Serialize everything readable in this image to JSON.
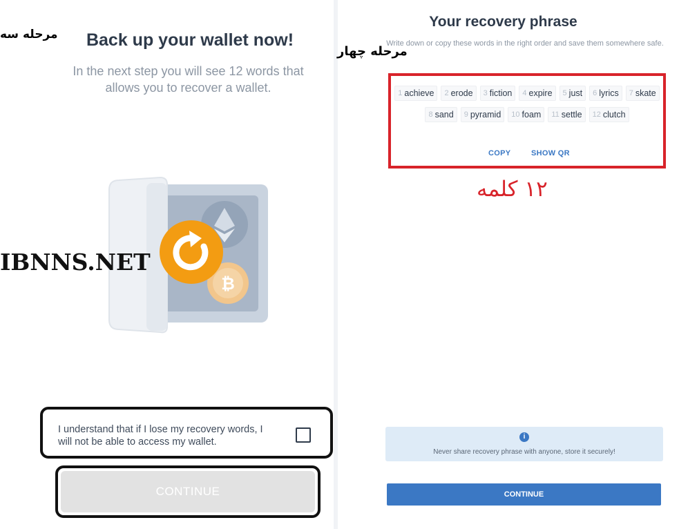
{
  "left": {
    "step_label": "مرحله سه",
    "title": "Back up your wallet now!",
    "description": "In the next step you will see 12 words that allows you to recover a wallet.",
    "watermark": "IBNNS.NET",
    "understand_text": "I understand that if I lose my recovery words, I will not be able to access my wallet.",
    "understand_checked": false,
    "continue_label": "CONTINUE"
  },
  "right": {
    "title": "Your recovery phrase",
    "description": "Write down or copy these words in the right order and save them somewhere safe.",
    "step_label": "مرحله چهار",
    "words": [
      {
        "num": "1",
        "word": "achieve"
      },
      {
        "num": "2",
        "word": "erode"
      },
      {
        "num": "3",
        "word": "fiction"
      },
      {
        "num": "4",
        "word": "expire"
      },
      {
        "num": "5",
        "word": "just"
      },
      {
        "num": "6",
        "word": "lyrics"
      },
      {
        "num": "7",
        "word": "skate"
      },
      {
        "num": "8",
        "word": "sand"
      },
      {
        "num": "9",
        "word": "pyramid"
      },
      {
        "num": "10",
        "word": "foam"
      },
      {
        "num": "11",
        "word": "settle"
      },
      {
        "num": "12",
        "word": "clutch"
      }
    ],
    "copy_label": "COPY",
    "show_qr_label": "SHOW QR",
    "annotation": "۱۲ کلمه",
    "info_icon": "i",
    "warning_text": "Never share recovery phrase with anyone, store it securely!",
    "continue_label": "CONTINUE"
  },
  "colors": {
    "accent_blue": "#3b78c4",
    "highlight_red": "#d8232a",
    "orange": "#f39c12",
    "disabled_gray": "#e2e2e2"
  }
}
